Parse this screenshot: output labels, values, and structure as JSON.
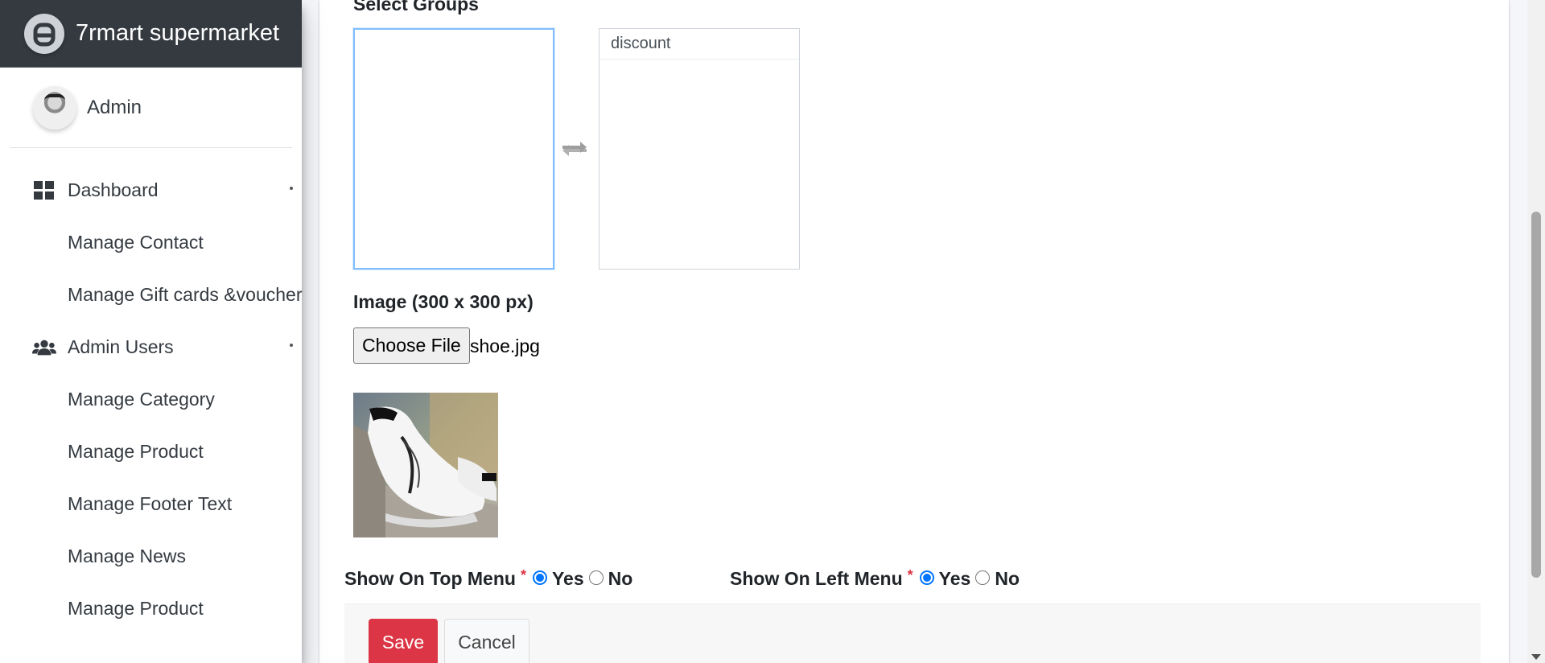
{
  "sidebar": {
    "brand": "7rmart supermarket",
    "user": "Admin",
    "items": [
      {
        "label": "Dashboard",
        "icon": "th-large-icon",
        "has_caret": true
      },
      {
        "label": "Manage Contact"
      },
      {
        "label": "Manage Gift cards &voucher"
      },
      {
        "label": "Admin Users",
        "icon": "users-icon",
        "has_caret": true
      },
      {
        "label": "Manage Category"
      },
      {
        "label": "Manage Product"
      },
      {
        "label": "Manage Footer Text"
      },
      {
        "label": "Manage News"
      },
      {
        "label": "Manage Product"
      }
    ]
  },
  "form": {
    "select_groups_label": "Select Groups",
    "groups_available": [],
    "groups_selected": [
      "discount"
    ],
    "image_label": "Image (300 x 300 px)",
    "choose_file_label": "Choose File",
    "file_name": "shoe.jpg",
    "top_menu_label": "Show On Top Menu",
    "left_menu_label": "Show On Left Menu",
    "required_mark": "*",
    "yes_label": "Yes",
    "no_label": "No",
    "top_menu_value": "Yes",
    "left_menu_value": "Yes",
    "save_label": "Save",
    "cancel_label": "Cancel"
  },
  "colors": {
    "brand_bg": "#343a40",
    "save": "#dc3545",
    "focus_border": "#80bdff",
    "radio": "#0075ff"
  }
}
